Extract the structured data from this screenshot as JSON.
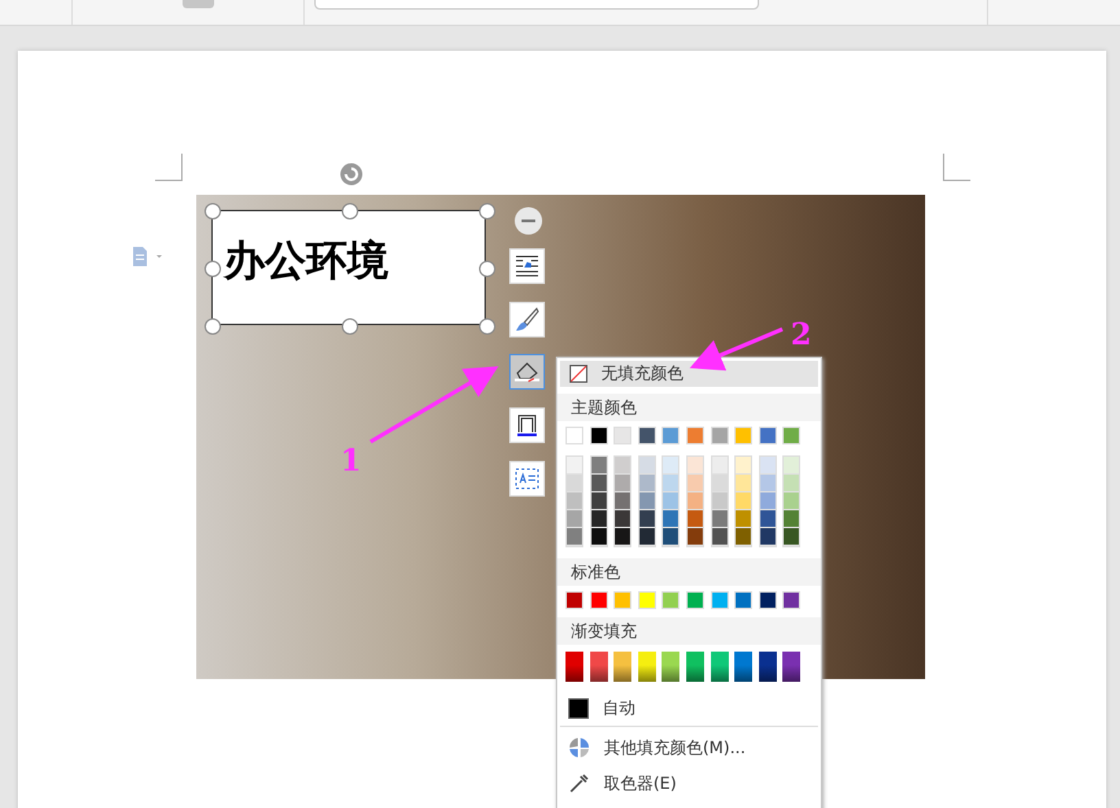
{
  "text_box": {
    "text": "办公环境"
  },
  "float_toolbar": [
    {
      "kind": "wrap",
      "selected": false
    },
    {
      "kind": "brush",
      "selected": false
    },
    {
      "kind": "fill",
      "selected": true
    },
    {
      "kind": "border",
      "selected": false
    },
    {
      "kind": "textbox",
      "selected": false
    }
  ],
  "annotations": [
    {
      "label": "1"
    },
    {
      "label": "2"
    }
  ],
  "fill_menu": {
    "no_fill": {
      "label": "无填充颜色",
      "selected": true
    },
    "theme_label": "主题颜色",
    "theme_colors": [
      {
        "color": "#ffffff",
        "shades": [
          {
            "color": "#f2f2f2"
          },
          {
            "color": "#d9d9d9"
          },
          {
            "color": "#bfbfbf"
          },
          {
            "color": "#a6a6a6"
          },
          {
            "color": "#808080"
          }
        ]
      },
      {
        "color": "#000000",
        "shades": [
          {
            "color": "#7f7f7f"
          },
          {
            "color": "#595959"
          },
          {
            "color": "#404040"
          },
          {
            "color": "#262626"
          },
          {
            "color": "#0d0d0d"
          }
        ]
      },
      {
        "color": "#e7e6e6",
        "shades": [
          {
            "color": "#d0cece"
          },
          {
            "color": "#aeabab"
          },
          {
            "color": "#757171"
          },
          {
            "color": "#3b3838"
          },
          {
            "color": "#171616"
          }
        ]
      },
      {
        "color": "#44546a",
        "shades": [
          {
            "color": "#d6dce5"
          },
          {
            "color": "#adb9ca"
          },
          {
            "color": "#8497b0"
          },
          {
            "color": "#333f50"
          },
          {
            "color": "#222a35"
          }
        ]
      },
      {
        "color": "#5b9bd5",
        "shades": [
          {
            "color": "#deebf7"
          },
          {
            "color": "#bdd7ee"
          },
          {
            "color": "#9dc3e6"
          },
          {
            "color": "#2e75b6"
          },
          {
            "color": "#1f4e79"
          }
        ]
      },
      {
        "color": "#ed7d31",
        "shades": [
          {
            "color": "#fbe5d6"
          },
          {
            "color": "#f8cbad"
          },
          {
            "color": "#f4b183"
          },
          {
            "color": "#c55a11"
          },
          {
            "color": "#843c0c"
          }
        ]
      },
      {
        "color": "#a5a5a5",
        "shades": [
          {
            "color": "#ededed"
          },
          {
            "color": "#dbdbdb"
          },
          {
            "color": "#c9c9c9"
          },
          {
            "color": "#7b7b7b"
          },
          {
            "color": "#525252"
          }
        ]
      },
      {
        "color": "#ffc000",
        "shades": [
          {
            "color": "#fff2cc"
          },
          {
            "color": "#ffe699"
          },
          {
            "color": "#ffd966"
          },
          {
            "color": "#bf9000"
          },
          {
            "color": "#7f6000"
          }
        ]
      },
      {
        "color": "#4472c4",
        "shades": [
          {
            "color": "#dae3f3"
          },
          {
            "color": "#b4c7e7"
          },
          {
            "color": "#8faadc"
          },
          {
            "color": "#2f5597"
          },
          {
            "color": "#203864"
          }
        ]
      },
      {
        "color": "#70ad47",
        "shades": [
          {
            "color": "#e2f0d9"
          },
          {
            "color": "#c5e0b4"
          },
          {
            "color": "#a9d18e"
          },
          {
            "color": "#548235"
          },
          {
            "color": "#385723"
          }
        ]
      }
    ],
    "standard_label": "标准色",
    "standard_colors": [
      {
        "color": "#c00000"
      },
      {
        "color": "#ff0000"
      },
      {
        "color": "#ffc000"
      },
      {
        "color": "#ffff00"
      },
      {
        "color": "#92d050"
      },
      {
        "color": "#00b050"
      },
      {
        "color": "#00b0f0"
      },
      {
        "color": "#0070c0"
      },
      {
        "color": "#002060"
      },
      {
        "color": "#7030a0"
      }
    ],
    "gradient_label": "渐变填充",
    "gradient_colors": [
      {
        "color": "#e00000"
      },
      {
        "color": "#f04848"
      },
      {
        "color": "#f5c040"
      },
      {
        "color": "#f5ee10"
      },
      {
        "color": "#9ad850"
      },
      {
        "color": "#10c060"
      },
      {
        "color": "#10c878"
      },
      {
        "color": "#0078d0"
      },
      {
        "color": "#0a3090"
      },
      {
        "color": "#7a30b0"
      }
    ],
    "auto": {
      "label": "自动",
      "selected": false
    },
    "items": [
      {
        "kind": "more",
        "label": "其他填充颜色(M)...",
        "selected": false
      },
      {
        "kind": "picker",
        "label": "取色器(E)",
        "selected": false
      }
    ]
  }
}
